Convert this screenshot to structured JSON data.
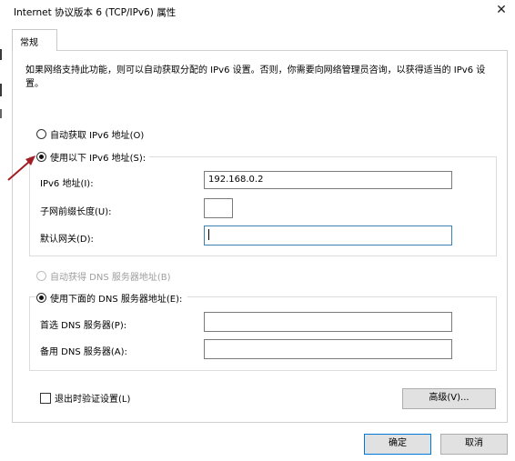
{
  "window": {
    "title": "Internet 协议版本 6 (TCP/IPv6) 属性",
    "close_glyph": "✕"
  },
  "tabs": [
    {
      "label": "常规"
    }
  ],
  "description": "如果网络支持此功能，则可以自动获取分配的 IPv6 设置。否则，你需要向网络管理员咨询，以获得适当的 IPv6 设置。",
  "ip_section": {
    "auto_label": "自动获取 IPv6 地址(O)",
    "auto_checked": false,
    "manual_label": "使用以下 IPv6 地址(S):",
    "manual_checked": true,
    "fields": [
      {
        "label": "IPv6 地址(I):",
        "value": "192.168.0.2"
      },
      {
        "label": "子网前缀长度(U):",
        "value": ""
      },
      {
        "label": "默认网关(D):",
        "value": ""
      }
    ]
  },
  "dns_section": {
    "auto_label": "自动获得 DNS 服务器地址(B)",
    "auto_checked": false,
    "auto_disabled": true,
    "manual_label": "使用下面的 DNS 服务器地址(E):",
    "manual_checked": true,
    "fields": [
      {
        "label": "首选 DNS 服务器(P):",
        "value": ""
      },
      {
        "label": "备用 DNS 服务器(A):",
        "value": ""
      }
    ]
  },
  "validate_on_exit": {
    "label": "退出时验证设置(L)",
    "checked": false
  },
  "buttons": {
    "advanced": "高级(V)...",
    "ok": "确定",
    "cancel": "取消"
  },
  "colors": {
    "annotation_arrow": "#a31d24",
    "focus_border": "#3c7fb1",
    "default_button_border": "#0078d7"
  }
}
